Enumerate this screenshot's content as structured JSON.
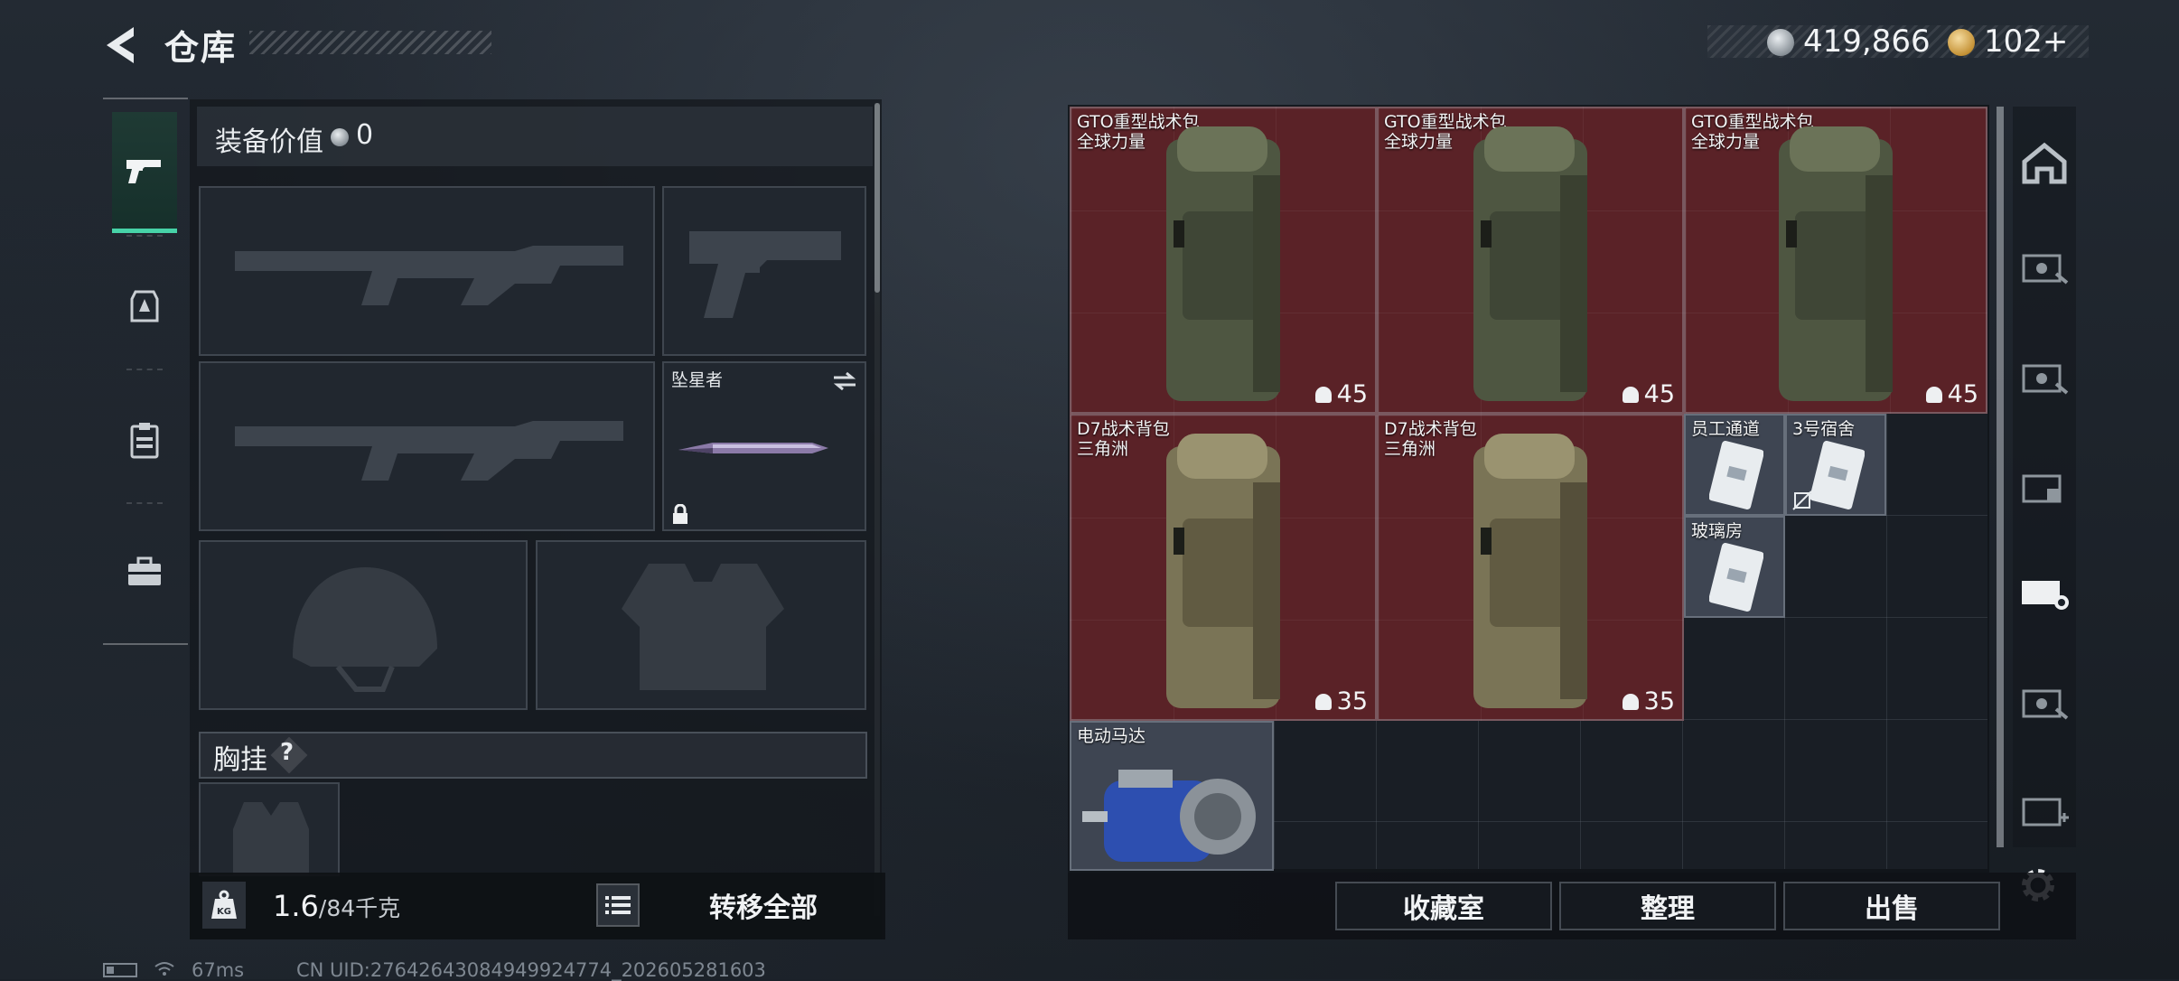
{
  "header": {
    "title": "仓库",
    "currency_silver": "419,866",
    "currency_gold": "102+"
  },
  "loadout": {
    "value_label": "装备价值",
    "value_amount": "0",
    "melee_slot_label": "坠星者",
    "chest_label": "胸挂",
    "chest_help": "?",
    "weight_current": "1.6",
    "weight_max": "/84千克",
    "kg_icon_text": "KG",
    "transfer_all": "转移全部"
  },
  "stash": {
    "items": [
      {
        "name": "GTO重型战术包",
        "sub": "全球力量",
        "capacity": "45"
      },
      {
        "name": "GTO重型战术包",
        "sub": "全球力量",
        "capacity": "45"
      },
      {
        "name": "GTO重型战术包",
        "sub": "全球力量",
        "capacity": "45"
      },
      {
        "name": "D7战术背包",
        "sub": "三角洲",
        "capacity": "35"
      },
      {
        "name": "D7战术背包",
        "sub": "三角洲",
        "capacity": "35"
      },
      {
        "name": "员工通道",
        "sub": ""
      },
      {
        "name": "3号宿舍",
        "sub": ""
      },
      {
        "name": "玻璃房",
        "sub": ""
      },
      {
        "name": "电动马达",
        "sub": ""
      }
    ],
    "buttons": {
      "collection": "收藏室",
      "organize": "整理",
      "sell": "出售"
    }
  },
  "status_bar": {
    "ping": "67ms",
    "uid": "CN UID:27642643084949924774_202605281603"
  },
  "colors": {
    "accent_green": "#47d3a8",
    "rare_red": "#5a2227",
    "key_gray": "#3e4552"
  },
  "icons": [
    "back-arrow-icon",
    "pistol-icon",
    "helmet-badge-icon",
    "clipboard-icon",
    "toolbox-icon",
    "kg-icon",
    "list-icon",
    "swap-icon",
    "lock-icon",
    "gear-icon"
  ]
}
